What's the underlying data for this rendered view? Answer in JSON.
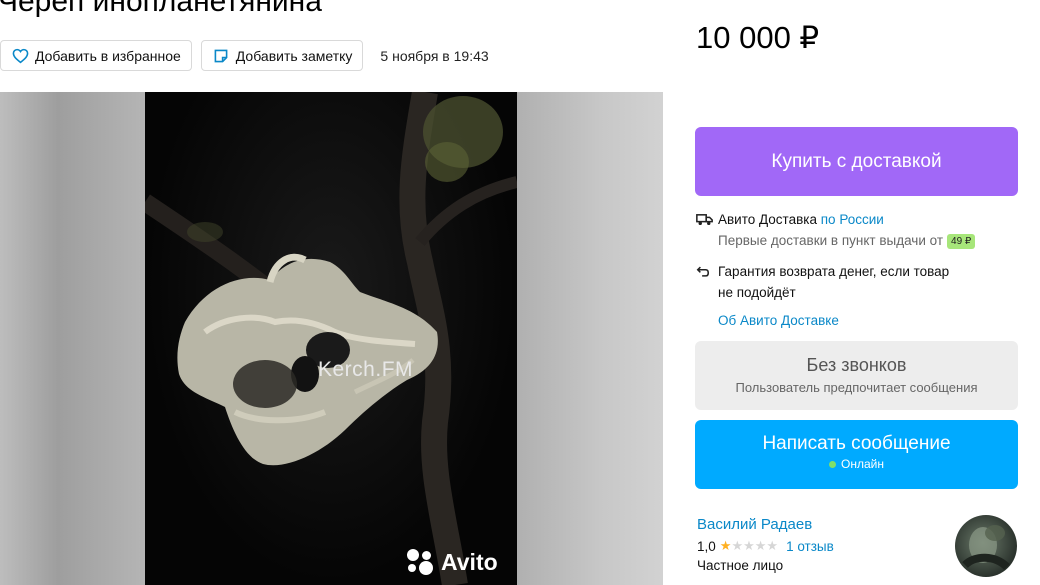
{
  "listing": {
    "title": "Череп инопланетянина",
    "date": "5 ноября в 19:43",
    "price": "10 000 ₽"
  },
  "actions": {
    "favorite_label": "Добавить в избранное",
    "note_label": "Добавить заметку"
  },
  "gallery": {
    "watermark": "Kerch.FM",
    "logo_text": "Avito"
  },
  "buy": {
    "label": "Купить с доставкой"
  },
  "delivery": {
    "service": "Авито Доставка",
    "region": "по России",
    "first_delivery": "Первые доставки в пункт выдачи от",
    "price_badge": "49 ₽",
    "guarantee": "Гарантия возврата денег, если товар",
    "guarantee_cont": "не подойдёт",
    "about_link": "Об Авито Доставке"
  },
  "no_calls": {
    "title": "Без звонков",
    "subtitle": "Пользователь предпочитает сообщения"
  },
  "message": {
    "label": "Написать сообщение",
    "status": "Онлайн"
  },
  "seller": {
    "name": "Василий Радаев",
    "rating": "1,0",
    "rating_value": 1,
    "rating_max": 5,
    "reviews": "1 отзыв",
    "type": "Частное лицо"
  },
  "colors": {
    "buy": "#a168f7",
    "message": "#00aaff",
    "link": "#0a88c8",
    "badge": "#a7e67a",
    "online": "#7fe06a",
    "star": "#ffb021"
  },
  "icons": [
    "heart-icon",
    "note-icon",
    "truck-icon",
    "return-arrow-icon",
    "avito-dots-icon",
    "star-icon"
  ]
}
